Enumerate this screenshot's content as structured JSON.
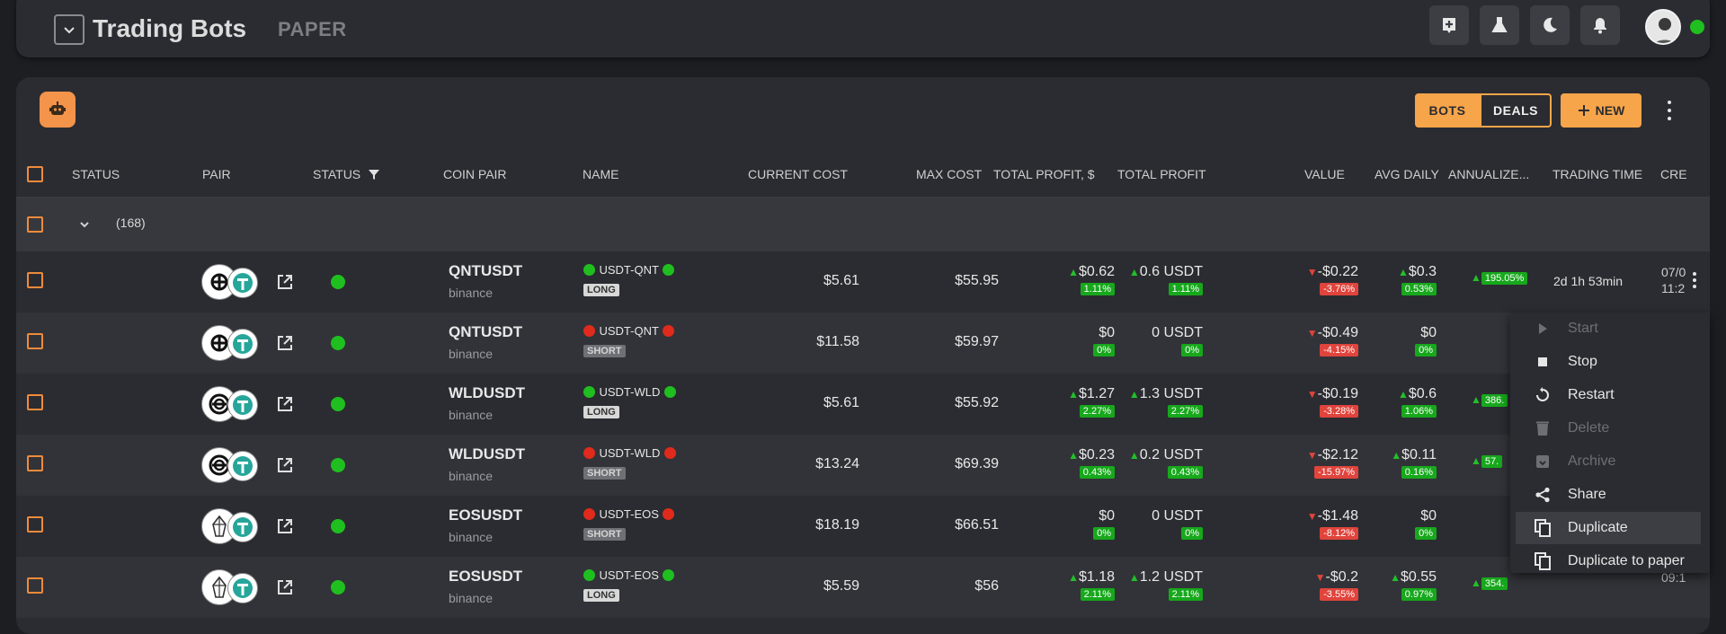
{
  "header": {
    "title": "Trading Bots",
    "mode": "PAPER"
  },
  "toolbar": {
    "bots_label": "BOTS",
    "deals_label": "DEALS",
    "new_label": "NEW"
  },
  "table": {
    "columns": {
      "status": "STATUS",
      "pair": "PAIR",
      "status_filter": "STATUS",
      "coin_pair": "COIN PAIR",
      "name": "NAME",
      "current_cost": "CURRENT COST",
      "max_cost": "MAX COST",
      "total_profit_usd": "TOTAL PROFIT, $",
      "total_profit": "TOTAL PROFIT",
      "value": "VALUE",
      "avg_daily": "AVG DAILY",
      "annualized": "ANNUALIZE...",
      "trading_time": "TRADING TIME",
      "created": "CRE"
    },
    "group": {
      "count": "(168)"
    },
    "rows": [
      {
        "pair": "QNTUSDT",
        "exchange": "binance",
        "name": "USDT-QNT",
        "side": "LONG",
        "name_status": "g",
        "current_cost": "$5.61",
        "max_cost": "$55.95",
        "tp_usd": "$0.62",
        "tp_usd_pct": "1.11%",
        "tp_usd_dir": "up",
        "tp": "0.6 USDT",
        "tp_pct": "1.11%",
        "tp_dir": "up",
        "value": "-$0.22",
        "value_pct": "-3.76%",
        "avg": "$0.3",
        "avg_pct": "0.53%",
        "avg_dir": "up",
        "annual": "195.05%",
        "trading_time": "2d 1h 53min",
        "created_1": "07/0",
        "created_2": "11:2"
      },
      {
        "pair": "QNTUSDT",
        "exchange": "binance",
        "name": "USDT-QNT",
        "side": "SHORT",
        "name_status": "r",
        "current_cost": "$11.58",
        "max_cost": "$59.97",
        "tp_usd": "$0",
        "tp_usd_pct": "0%",
        "tp_usd_dir": "",
        "tp": "0 USDT",
        "tp_pct": "0%",
        "tp_dir": "",
        "value": "-$0.49",
        "value_pct": "-4.15%",
        "avg": "$0",
        "avg_pct": "0%",
        "avg_dir": "",
        "annual": "",
        "trading_time": "",
        "created_1": "",
        "created_2": ""
      },
      {
        "pair": "WLDUSDT",
        "exchange": "binance",
        "name": "USDT-WLD",
        "side": "LONG",
        "name_status": "g",
        "current_cost": "$5.61",
        "max_cost": "$55.92",
        "tp_usd": "$1.27",
        "tp_usd_pct": "2.27%",
        "tp_usd_dir": "up",
        "tp": "1.3 USDT",
        "tp_pct": "2.27%",
        "tp_dir": "up",
        "value": "-$0.19",
        "value_pct": "-3.28%",
        "avg": "$0.6",
        "avg_pct": "1.06%",
        "avg_dir": "up",
        "annual": "386.",
        "trading_time": "",
        "created_1": "",
        "created_2": ""
      },
      {
        "pair": "WLDUSDT",
        "exchange": "binance",
        "name": "USDT-WLD",
        "side": "SHORT",
        "name_status": "r",
        "current_cost": "$13.24",
        "max_cost": "$69.39",
        "tp_usd": "$0.23",
        "tp_usd_pct": "0.43%",
        "tp_usd_dir": "up",
        "tp": "0.2 USDT",
        "tp_pct": "0.43%",
        "tp_dir": "up",
        "value": "-$2.12",
        "value_pct": "-15.97%",
        "avg": "$0.11",
        "avg_pct": "0.16%",
        "avg_dir": "up",
        "annual": "57.",
        "trading_time": "",
        "created_1": "",
        "created_2": ""
      },
      {
        "pair": "EOSUSDT",
        "exchange": "binance",
        "name": "USDT-EOS",
        "side": "SHORT",
        "name_status": "r",
        "current_cost": "$18.19",
        "max_cost": "$66.51",
        "tp_usd": "$0",
        "tp_usd_pct": "0%",
        "tp_usd_dir": "",
        "tp": "0 USDT",
        "tp_pct": "0%",
        "tp_dir": "",
        "value": "-$1.48",
        "value_pct": "-8.12%",
        "avg": "$0",
        "avg_pct": "0%",
        "avg_dir": "",
        "annual": "",
        "trading_time": "",
        "created_1": "",
        "created_2": ""
      },
      {
        "pair": "EOSUSDT",
        "exchange": "binance",
        "name": "USDT-EOS",
        "side": "LONG",
        "name_status": "g",
        "current_cost": "$5.59",
        "max_cost": "$56",
        "tp_usd": "$1.18",
        "tp_usd_pct": "2.11%",
        "tp_usd_dir": "up",
        "tp": "1.2 USDT",
        "tp_pct": "2.11%",
        "tp_dir": "up",
        "value": "-$0.2",
        "value_pct": "-3.55%",
        "avg": "$0.55",
        "avg_pct": "0.97%",
        "avg_dir": "up",
        "annual": "354.",
        "trading_time": "",
        "created_1": "",
        "created_2": "09:1"
      }
    ]
  },
  "context_menu": {
    "items": [
      {
        "label": "Start",
        "icon": "play-icon",
        "disabled": true
      },
      {
        "label": "Stop",
        "icon": "stop-icon",
        "disabled": false
      },
      {
        "label": "Restart",
        "icon": "restart-icon",
        "disabled": false
      },
      {
        "label": "Delete",
        "icon": "trash-icon",
        "disabled": true
      },
      {
        "label": "Archive",
        "icon": "archive-icon",
        "disabled": true
      },
      {
        "label": "Share",
        "icon": "share-icon",
        "disabled": false
      },
      {
        "label": "Duplicate",
        "icon": "copy-icon",
        "disabled": false
      },
      {
        "label": "Duplicate to paper",
        "icon": "copy-icon",
        "disabled": false
      }
    ]
  }
}
